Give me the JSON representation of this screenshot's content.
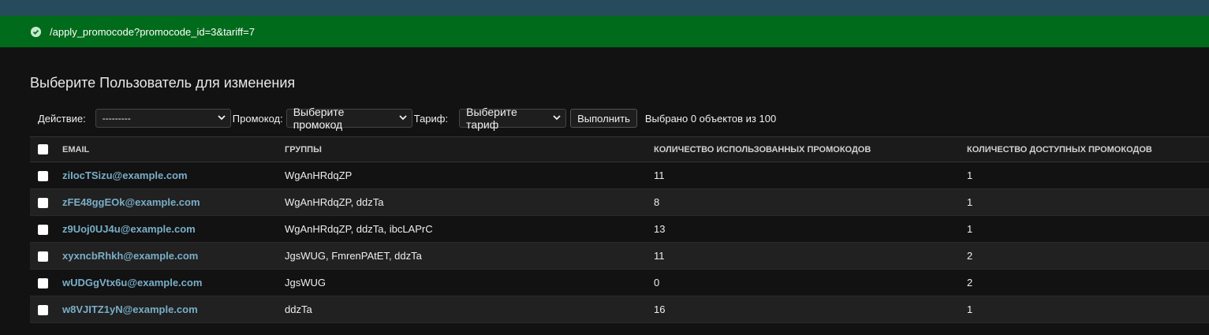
{
  "message": {
    "text": "/apply_promocode?promocode_id=3&tariff=7",
    "icon": "check-circle-icon",
    "color": "#006b1b"
  },
  "page_title": "Выберите Пользователь для изменения",
  "actions": {
    "action_label": "Действие:",
    "action_value": "---------",
    "promo_label": "Промокод:",
    "promo_value": "Выберите промокод",
    "tariff_label": "Тариф:",
    "tariff_value": "Выберите тариф",
    "go_label": "Выполнить",
    "selected_counter": "Выбрано 0 объектов из 100"
  },
  "table": {
    "headers": [
      "EMAIL",
      "ГРУППЫ",
      "КОЛИЧЕСТВО ИСПОЛЬЗОВАННЫХ ПРОМОКОДОВ",
      "КОЛИЧЕСТВО ДОСТУПНЫХ ПРОМОКОДОВ"
    ],
    "rows": [
      {
        "email": "ziIocTSizu@example.com",
        "groups": "WgAnHRdqZP",
        "used": "11",
        "available": "1"
      },
      {
        "email": "zFE48ggEOk@example.com",
        "groups": "WgAnHRdqZP, ddzTa",
        "used": "8",
        "available": "1"
      },
      {
        "email": "z9Uoj0UJ4u@example.com",
        "groups": "WgAnHRdqZP, ddzTa, ibcLAPrC",
        "used": "13",
        "available": "1"
      },
      {
        "email": "xyxncbRhkh@example.com",
        "groups": "JgsWUG, FmrenPAtET, ddzTa",
        "used": "11",
        "available": "2"
      },
      {
        "email": "wUDGgVtx6u@example.com",
        "groups": "JgsWUG",
        "used": "0",
        "available": "2"
      },
      {
        "email": "w8VJITZ1yN@example.com",
        "groups": "ddzTa",
        "used": "16",
        "available": "1"
      }
    ]
  },
  "colors": {
    "link": "#79aec8",
    "header_bar": "#264b5d",
    "background": "#121212"
  }
}
